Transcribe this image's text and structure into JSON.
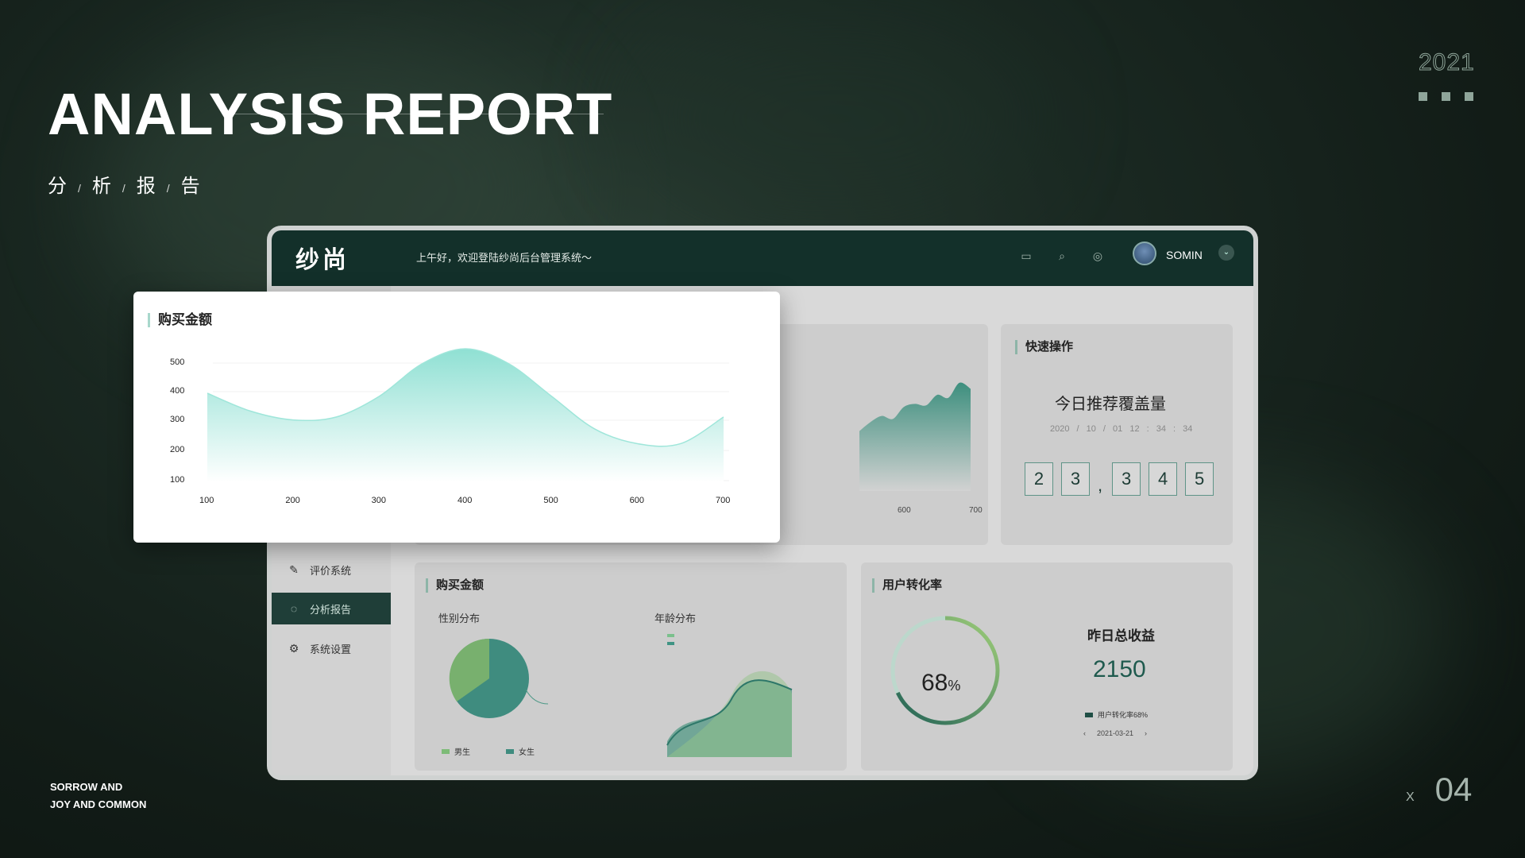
{
  "slide": {
    "title": "ANALYSIS REPORT",
    "subtitle_chars": [
      "分",
      "析",
      "报",
      "告"
    ],
    "subtitle_sep": "/",
    "year": "2021",
    "footer_line1": "SORROW AND",
    "footer_line2": "JOY AND COMMON",
    "page_prefix": "X",
    "page_number": "04"
  },
  "header": {
    "logo": "纱尚",
    "greeting": "上午好，欢迎登陆纱尚后台管理系统～",
    "icons": [
      "message-icon",
      "search-icon",
      "settings-icon"
    ],
    "user_name": "SOMIN"
  },
  "sidebar": {
    "items": [
      {
        "label": "评价系统",
        "icon": "pencil-icon",
        "active": false
      },
      {
        "label": "分析报告",
        "icon": "chat-icon",
        "active": true
      },
      {
        "label": "系统设置",
        "icon": "gear-icon",
        "active": false
      }
    ]
  },
  "quick": {
    "title": "快速操作",
    "heading": "今日推荐覆盖量",
    "date": "2020 / 10 / 01",
    "time": "12 : 34 : 34",
    "digits_a": [
      "2",
      "3"
    ],
    "digits_b": [
      "3",
      "4",
      "5"
    ],
    "separator": ","
  },
  "purchase_bottom": {
    "title": "购买金额",
    "gender_label": "性别分布",
    "age_label": "年龄分布",
    "legend_male": "男生",
    "legend_female": "女生"
  },
  "conversion": {
    "title": "用户转化率",
    "ring_value": "68",
    "ring_unit": "%",
    "ring_fraction": 0.68,
    "earnings_title": "昨日总收益",
    "earnings_value": "2150",
    "legend": "用户转化率68%",
    "date": "2021-03-21"
  },
  "colors": {
    "topbar": "#13302a",
    "accent": "#3d8f7e",
    "mint": "#8fe0d3"
  },
  "chart_data": [
    {
      "type": "area",
      "title": "购买金额",
      "x": [
        100,
        150,
        200,
        250,
        300,
        350,
        400,
        450,
        500,
        550,
        600,
        650,
        700
      ],
      "values": [
        400,
        340,
        310,
        320,
        390,
        500,
        550,
        500,
        390,
        280,
        230,
        230,
        320
      ],
      "yticks": [
        100,
        200,
        300,
        400,
        500
      ],
      "xticks": [
        100,
        200,
        300,
        400,
        500,
        600,
        700
      ],
      "ylim": [
        100,
        550
      ],
      "xlim": [
        100,
        700
      ]
    },
    {
      "type": "area",
      "values": [
        330,
        360,
        380,
        370,
        410,
        420,
        415,
        450,
        440,
        490,
        470
      ],
      "xticks": [
        600,
        700
      ]
    }
  ]
}
